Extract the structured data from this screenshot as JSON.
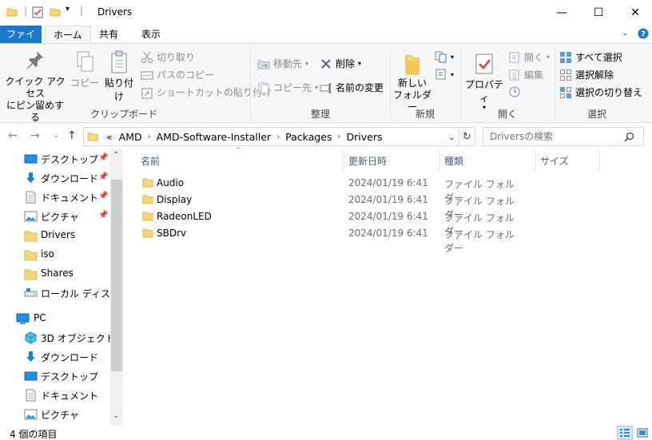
{
  "window": {
    "title": "Drivers",
    "minimize_glyph": "—",
    "maximize_glyph": "☐",
    "close_glyph": "✕"
  },
  "ribbon_tabs": [
    {
      "label": "ファイル"
    },
    {
      "label": "ホーム"
    },
    {
      "label": "共有"
    },
    {
      "label": "表示"
    }
  ],
  "ribbon": {
    "clipboard": {
      "pin_quick_access": "クイック アクセス\nにピン留めする",
      "copy": "コピー",
      "paste": "貼り付け",
      "cut": "切り取り",
      "copy_path": "パスのコピー",
      "paste_shortcut": "ショートカットの貼り付け",
      "group_label": "クリップボード"
    },
    "organize": {
      "move_to": "移動先",
      "copy_to": "コピー先",
      "delete": "削除",
      "rename": "名前の変更",
      "group_label": "整理"
    },
    "new": {
      "new_folder": "新しい\nフォルダー",
      "group_label": "新規"
    },
    "open": {
      "properties": "プロパティ",
      "open": "開く",
      "edit": "編集",
      "group_label": "開く"
    },
    "select": {
      "select_all": "すべて選択",
      "select_none": "選択解除",
      "invert_selection": "選択の切り替え",
      "group_label": "選択"
    }
  },
  "address": {
    "overflow": "«",
    "crumbs": [
      "AMD",
      "AMD-Software-Installer",
      "Packages",
      "Drivers"
    ],
    "search_placeholder": "Driversの検索"
  },
  "nav_pane": {
    "quick_access": [
      {
        "label": "デスクトップ",
        "icon": "desktop-icon",
        "pinned": true
      },
      {
        "label": "ダウンロード",
        "icon": "download-icon",
        "pinned": true
      },
      {
        "label": "ドキュメント",
        "icon": "document-icon",
        "pinned": true
      },
      {
        "label": "ピクチャ",
        "icon": "pictures-icon",
        "pinned": true
      },
      {
        "label": "Drivers",
        "icon": "folder-icon",
        "pinned": false
      },
      {
        "label": "iso",
        "icon": "folder-icon",
        "pinned": false
      },
      {
        "label": "Shares",
        "icon": "folder-icon",
        "pinned": false
      },
      {
        "label": "ローカル ディスク (C",
        "icon": "drive-icon",
        "pinned": false
      }
    ],
    "pc_label": "PC",
    "pc_items": [
      {
        "label": "3D オブジェクト",
        "icon": "3d-objects-icon"
      },
      {
        "label": "ダウンロード",
        "icon": "download-icon"
      },
      {
        "label": "デスクトップ",
        "icon": "desktop-icon"
      },
      {
        "label": "ドキュメント",
        "icon": "document-icon"
      },
      {
        "label": "ピクチャ",
        "icon": "pictures-icon"
      }
    ]
  },
  "columns": {
    "name": "名前",
    "modified": "更新日時",
    "type": "種類",
    "size": "サイズ"
  },
  "files": [
    {
      "name": "Audio",
      "modified": "2024/01/19 6:41",
      "type": "ファイル フォルダー"
    },
    {
      "name": "Display",
      "modified": "2024/01/19 6:41",
      "type": "ファイル フォルダー"
    },
    {
      "name": "RadeonLED",
      "modified": "2024/01/19 6:41",
      "type": "ファイル フォルダー"
    },
    {
      "name": "SBDrv",
      "modified": "2024/01/19 6:41",
      "type": "ファイル フォルダー"
    }
  ],
  "status": {
    "item_count": "4 個の項目"
  },
  "colors": {
    "accent": "#1979ca",
    "folder": "#f8d775",
    "folder_dark": "#e8b744",
    "ribbon_bg": "#f5f6f7",
    "header_text": "#4c607a"
  }
}
